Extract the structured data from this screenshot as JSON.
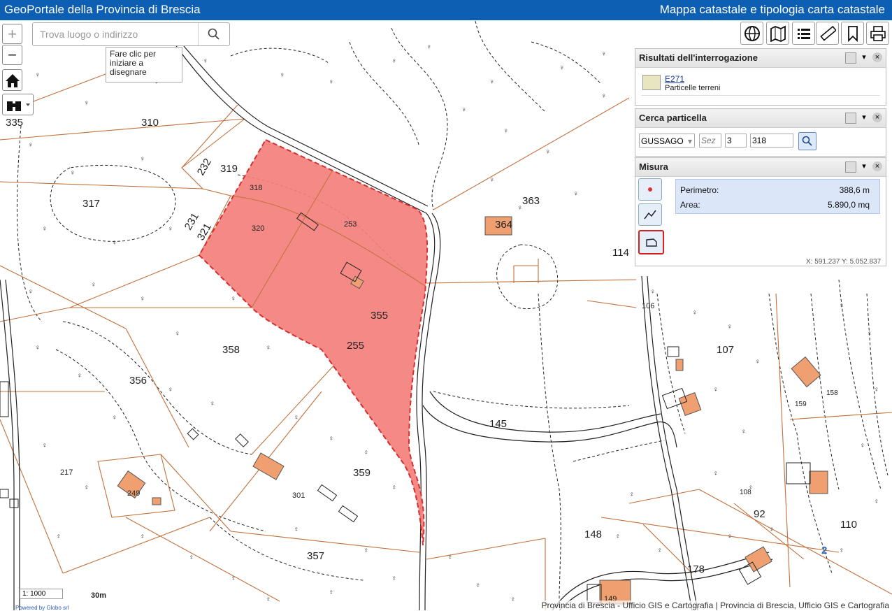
{
  "header": {
    "title_left": "GeoPortale della Provincia di Brescia",
    "title_right": "Mappa catastale e tipologia carta catastale"
  },
  "search": {
    "placeholder": "Trova luogo o indirizzo"
  },
  "tooltip": {
    "lines": [
      "Fare clic per",
      "iniziare a",
      "disegnare"
    ]
  },
  "zoom": {
    "in": "+",
    "out": "−"
  },
  "toolbar": {
    "icons": [
      "globe-icon",
      "map-icon",
      "list-icon",
      "ruler-icon",
      "bookmark-icon",
      "print-icon"
    ]
  },
  "panels": {
    "results": {
      "title": "Risultati dell'interrogazione",
      "link": "E271",
      "sublabel": "Particelle terreni"
    },
    "cerca": {
      "title": "Cerca particella",
      "comune": "GUSSAGO",
      "sez_placeholder": "Sez",
      "foglio": "3",
      "particella": "318"
    },
    "misura": {
      "title": "Misura",
      "perimetro_label": "Perimetro:",
      "perimetro_value": "388,6 m",
      "area_label": "Area:",
      "area_value": "5.890,0 mq"
    }
  },
  "coords": "X: 591.237 Y: 5.052.837",
  "scale": {
    "ratio": "1: 1000",
    "bar": "30m",
    "powered": "Powered by Globo srl"
  },
  "attribution": "Provincia di Brescia - Ufficio GIS e Cartografia | Provincia di Brescia, Ufficio GIS e Cartografia",
  "parcel_labels": [
    "335",
    "310",
    "319",
    "232",
    "317",
    "231",
    "321",
    "318",
    "320",
    "253",
    "355",
    "255",
    "358",
    "356",
    "363",
    "364",
    "114",
    "106",
    "107",
    "145",
    "217",
    "249",
    "301",
    "359",
    "357",
    "148",
    "178",
    "92",
    "110",
    "108",
    "158",
    "159",
    "2",
    "149"
  ],
  "colors": {
    "header": "#0d5fb3",
    "parcel_line": "#c2703a",
    "selection_fill": "#f47f7b",
    "selection_line": "#d32f2f",
    "building": "#f0a070"
  }
}
